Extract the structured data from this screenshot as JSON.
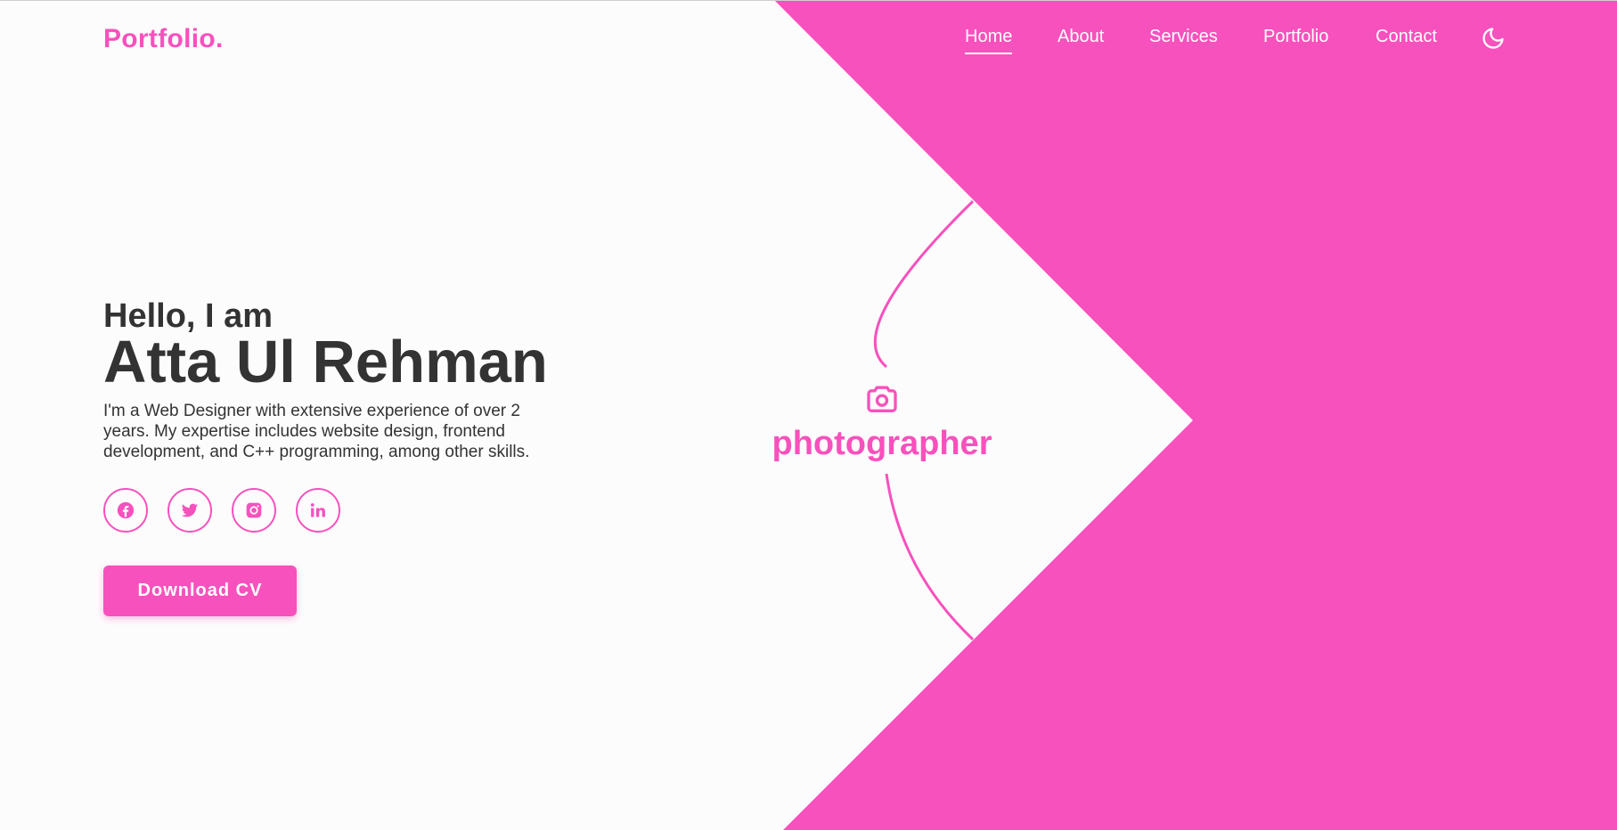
{
  "header": {
    "logo": "Portfolio."
  },
  "nav": {
    "items": [
      {
        "label": "Home",
        "active": true
      },
      {
        "label": "About",
        "active": false
      },
      {
        "label": "Services",
        "active": false
      },
      {
        "label": "Portfolio",
        "active": false
      },
      {
        "label": "Contact",
        "active": false
      }
    ],
    "theme_toggle_icon": "moon-icon"
  },
  "hero": {
    "greeting": "Hello, I am",
    "name": "Atta Ul Rehman",
    "description": "I'm a Web Designer with extensive experience of over 2 years. My expertise includes website design, frontend development, and C++ programming, among other skills.",
    "socials": [
      {
        "icon": "facebook-icon"
      },
      {
        "icon": "twitter-icon"
      },
      {
        "icon": "instagram-icon"
      },
      {
        "icon": "linkedin-icon"
      }
    ],
    "download_label": "Download CV"
  },
  "role": {
    "icon": "camera-icon",
    "label": "photographer"
  },
  "colors": {
    "accent": "#f751bd",
    "text": "#333333",
    "background": "#fcfcfc"
  }
}
